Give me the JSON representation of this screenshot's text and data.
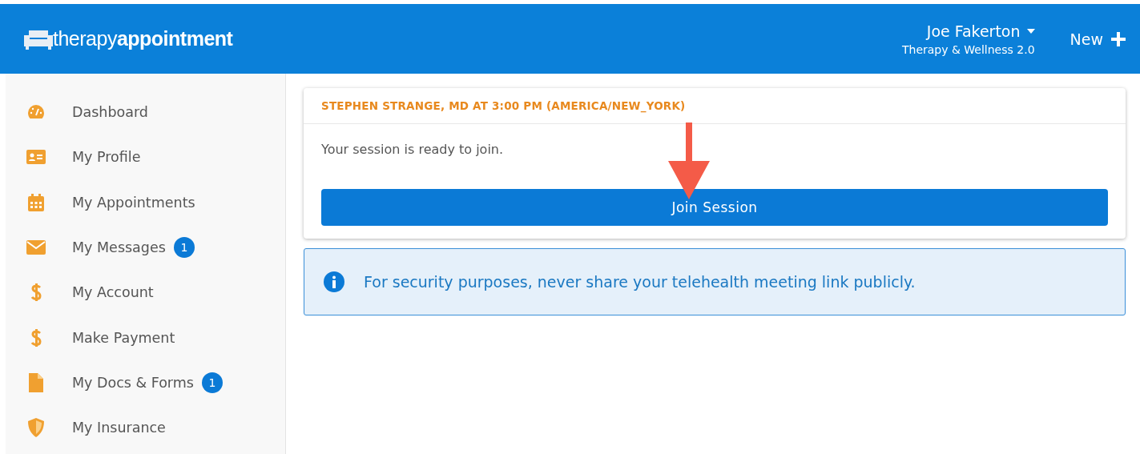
{
  "header": {
    "logo_light": "therapy",
    "logo_bold": "appointment",
    "user_name": "Joe Fakerton",
    "practice": "Therapy & Wellness 2.0",
    "new_label": "New"
  },
  "sidebar": {
    "items": [
      {
        "kind": "gauge",
        "label": "Dashboard"
      },
      {
        "kind": "idcard",
        "label": "My Profile"
      },
      {
        "kind": "calendar",
        "label": "My Appointments"
      },
      {
        "kind": "envelope",
        "label": "My Messages",
        "badge": "1"
      },
      {
        "kind": "dollar",
        "label": "My Account"
      },
      {
        "kind": "dollar",
        "label": "Make Payment"
      },
      {
        "kind": "file",
        "label": "My Docs & Forms",
        "badge": "1"
      },
      {
        "kind": "shield",
        "label": "My Insurance"
      }
    ]
  },
  "session_card": {
    "title": "STEPHEN STRANGE, MD AT 3:00 PM (AMERICA/NEW_YORK)",
    "message": "Your session is ready to join.",
    "button": "Join Session"
  },
  "alert": {
    "text": "For security purposes, never share your telehealth meeting link publicly."
  }
}
